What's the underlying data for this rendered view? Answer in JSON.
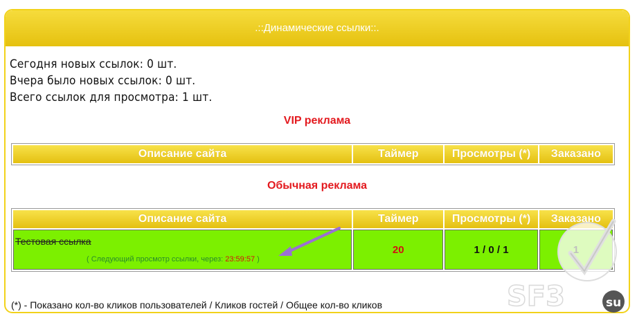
{
  "panel": {
    "title": ".::Динамические ссылки::."
  },
  "stats": {
    "today": "Сегодня новых ссылок: 0 шт.",
    "yesterday": "Вчера было новых ссылок: 0 шт.",
    "total": "Всего ссылок для просмотра: 1 шт."
  },
  "vip": {
    "title": "VIP реклама",
    "columns": [
      "Описание сайта",
      "Таймер",
      "Просмотры (*)",
      "Заказано"
    ]
  },
  "regular": {
    "title": "Обычная реклама",
    "columns": [
      "Описание сайта",
      "Таймер",
      "Просмотры (*)",
      "Заказано"
    ],
    "rows": [
      {
        "title": "Тестовая ссылка",
        "next_view_prefix": "( Следующий просмотр ссылки, через: ",
        "next_view_time": "23:59:57",
        "next_view_suffix": " )",
        "timer": "20",
        "views": "1 / 0 / 1",
        "ordered": "1"
      }
    ]
  },
  "footnote": "(*) - Показано кол-во кликов пользователей / Кликов гостей / Общее кол-во кликов",
  "watermark": {
    "text": "SF3",
    "suffix": "su"
  },
  "colors": {
    "accent": "#f2d21a",
    "row_green": "#7cf000",
    "red": "#e3191e",
    "arrow": "#9b6fd4"
  }
}
